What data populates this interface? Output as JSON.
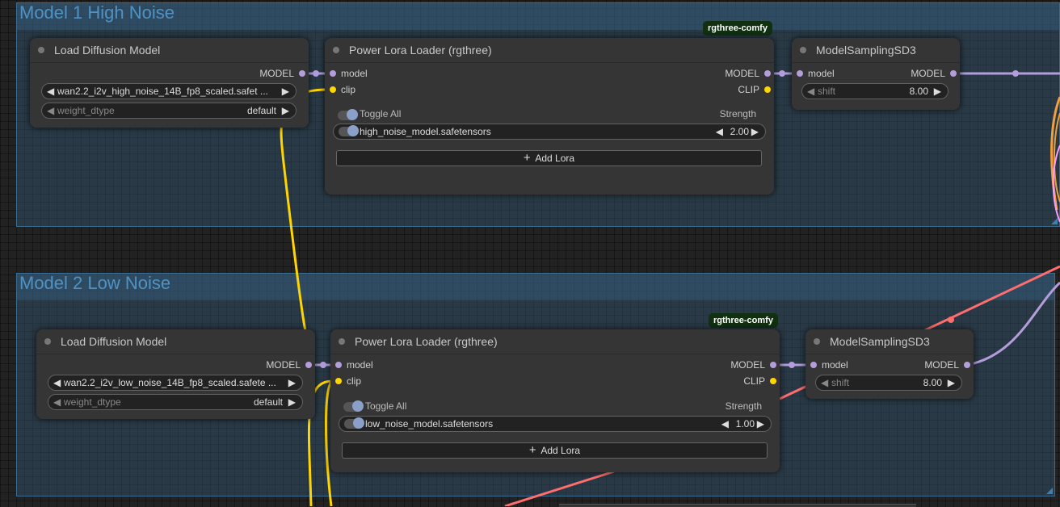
{
  "groups": [
    {
      "title": "Model 1 High Noise"
    },
    {
      "title": "Model 2 Low Noise"
    }
  ],
  "badge_text": "rgthree-comfy",
  "high": {
    "load": {
      "title": "Load Diffusion Model",
      "output": "MODEL",
      "unet_name": "wan2.2_i2v_high_noise_14B_fp8_scaled.safet ...",
      "weight_dtype_label": "weight_dtype",
      "weight_dtype_value": "default"
    },
    "lora": {
      "title": "Power Lora Loader (rgthree)",
      "in_model": "model",
      "in_clip": "clip",
      "out_model": "MODEL",
      "out_clip": "CLIP",
      "toggle_all": "Toggle All",
      "strength_header": "Strength",
      "lora_name": "high_noise_model.safetensors",
      "lora_strength": "2.00",
      "add_lora": "Add Lora"
    },
    "sampling": {
      "title": "ModelSamplingSD3",
      "in_model": "model",
      "out_model": "MODEL",
      "shift_label": "shift",
      "shift_value": "8.00"
    }
  },
  "low": {
    "load": {
      "title": "Load Diffusion Model",
      "output": "MODEL",
      "unet_name": "wan2.2_i2v_low_noise_14B_fp8_scaled.safete ...",
      "weight_dtype_label": "weight_dtype",
      "weight_dtype_value": "default"
    },
    "lora": {
      "title": "Power Lora Loader (rgthree)",
      "in_model": "model",
      "in_clip": "clip",
      "out_model": "MODEL",
      "out_clip": "CLIP",
      "toggle_all": "Toggle All",
      "strength_header": "Strength",
      "lora_name": "low_noise_model.safetensors",
      "lora_strength": "1.00",
      "add_lora": "Add Lora"
    },
    "sampling": {
      "title": "ModelSamplingSD3",
      "in_model": "model",
      "out_model": "MODEL",
      "shift_label": "shift",
      "shift_value": "8.00"
    }
  },
  "colors": {
    "model_wire": "#b39ddb",
    "clip_wire": "#ffd500",
    "vae_wire": "#ff6e6e",
    "pink_wire": "#ff9cf9",
    "orange_wire": "#f0a040",
    "group_fill": "#345a78"
  },
  "icons": {
    "left_arrow": "◀",
    "right_arrow": "▶",
    "plus": "+"
  }
}
